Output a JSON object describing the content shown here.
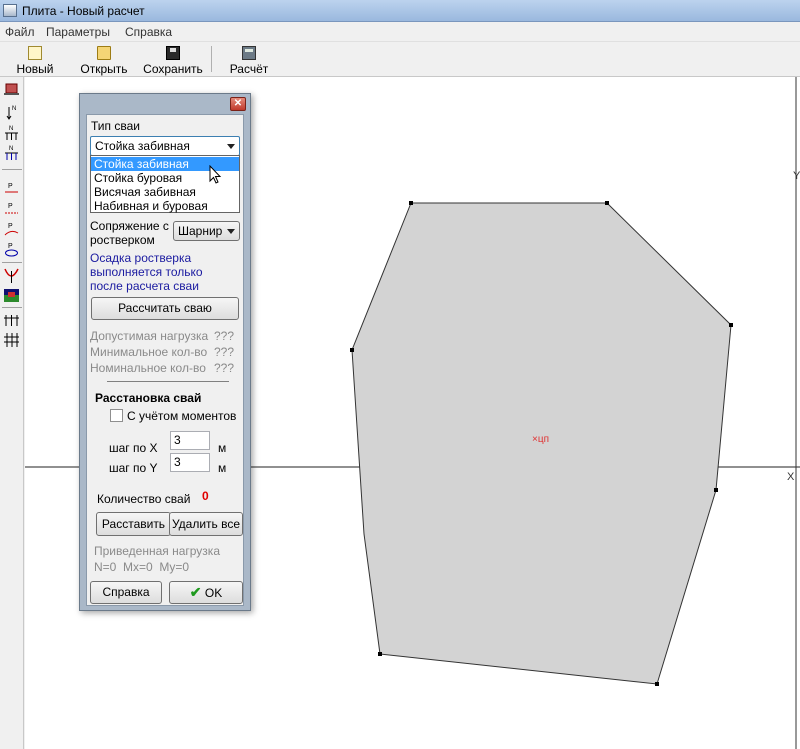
{
  "window": {
    "title": "Плита - Новый расчет"
  },
  "menu": {
    "items": [
      "Файл",
      "Параметры",
      "Справка"
    ]
  },
  "toolbar": {
    "new_label": "Новый",
    "open_label": "Открыть",
    "save_label": "Сохранить",
    "calc_label": "Расчёт"
  },
  "left_tools": {
    "icons": [
      "building-icon",
      "pile-n-icon",
      "pile-group-icon",
      "pile-grid-icon",
      "pile-p-icon",
      "pile-p-hatched-icon",
      "pile-p-curve-icon",
      "pile-p-ellipse-icon",
      "moment-icon",
      "color-map-icon",
      "piles-row-icon",
      "piles-grid-icon"
    ]
  },
  "canvas": {
    "center_label": "×цп",
    "axis_y_label": "Y",
    "axis_x_label": "X"
  },
  "dialog": {
    "close_glyph": "✕",
    "pile_type_label": "Тип сваи",
    "pile_type_selected": "Стойка забивная",
    "pile_type_options": [
      "Стойка забивная",
      "Стойка буровая",
      "Висячая забивная",
      "Набивная и буровая"
    ],
    "connection_label_1": "Сопряжение с",
    "connection_label_2": "ростверком",
    "connection_value": "Шарнир",
    "note_line_1": "Осадка ростверка",
    "note_line_2": "выполняется только",
    "note_line_3": "после расчета сваи",
    "calc_pile_button": "Рассчитать сваю",
    "allowable_load_label": "Допустимая нагрузка",
    "allowable_load_value": "???",
    "min_count_label": "Минимальное кол-во",
    "min_count_value": "???",
    "nominal_count_label": "Номинальное кол-во",
    "nominal_count_value": "???",
    "placement_header": "Расстановка свай",
    "moments_checkbox_label": "С учётом моментов",
    "step_x_label": "шаг по X",
    "step_x_value": "3",
    "step_y_label": "шаг по Y",
    "step_y_value": "3",
    "unit_m": "м",
    "pile_count_label": "Количество свай",
    "pile_count_value": "0",
    "place_button": "Расставить",
    "delete_all_button": "Удалить все",
    "reduced_load_label": "Приведенная нагрузка",
    "reduced_load_values": "N=0  Mx=0  My=0",
    "help_button": "Справка",
    "ok_button": "OK"
  },
  "colors": {
    "slab_fill": "#d3d3d3",
    "accent_blue": "#3399ff",
    "note_blue": "#1a1aa0",
    "count_red": "#e00000"
  }
}
